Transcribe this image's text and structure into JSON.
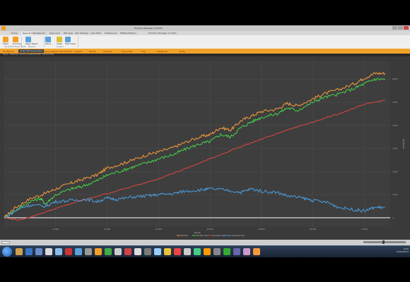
{
  "window": {
    "title": "Hold'em Manager 2 [Hold]"
  },
  "ribbon_tabs": [
    {
      "label": "Home",
      "active": false
    },
    {
      "label": "Reports",
      "active": true
    },
    {
      "label": "Multi-Reports",
      "active": false
    },
    {
      "label": "Opponent",
      "active": false
    },
    {
      "label": "HM Apps",
      "active": false
    },
    {
      "label": "Site Settings",
      "active": false
    },
    {
      "label": "Leak Filter",
      "active": false
    },
    {
      "label": "Preferences",
      "active": false
    },
    {
      "label": "HMHandhistory",
      "active": false
    },
    {
      "label": "Hold'em Manager 2 (Hold)",
      "active": false
    }
  ],
  "ribbon": {
    "buttons": [
      {
        "label": "Filters",
        "color": "#f2a023"
      },
      {
        "label": "Summary",
        "color": "#f2a023"
      },
      {
        "label": "Player Report",
        "color": "#5aa0dc"
      },
      {
        "label": "Hands",
        "color": "#5aa0dc"
      },
      {
        "label": "Graph",
        "color": "#e1c02e"
      },
      {
        "label": "Table Views",
        "color": "#5aa0dc"
      }
    ],
    "groups": [
      "Show/Hide Player Stats",
      "Reports",
      "Graphs"
    ]
  },
  "doc_tabs": [
    {
      "label": "My Reports",
      "active": false
    },
    {
      "label": "Graph Winnings Graph",
      "active": true
    },
    {
      "label": "Session/Hands",
      "active": false
    },
    {
      "label": "Hand History",
      "active": false
    },
    {
      "label": "Graphs",
      "active": false
    },
    {
      "label": "Results",
      "active": false
    },
    {
      "label": "Positions",
      "active": false
    },
    {
      "label": "Hole Cards",
      "active": false
    },
    {
      "label": "Flop",
      "active": false
    },
    {
      "label": "Situational",
      "active": false
    },
    {
      "label": "Notes",
      "active": false
    }
  ],
  "subbar": {
    "text": "Player: [Default]  Currency: [Default]  Filter: Default Filter"
  },
  "colors": {
    "chart_bg": "#3a3a3a",
    "orange": "#f39a3c",
    "green": "#45d24a",
    "red": "#e0473f",
    "blue": "#4a9ee0"
  },
  "chart_data": {
    "type": "line",
    "xlabel": "Hands",
    "ylabel": "Big Blinds",
    "x_ticks": [
      "10,000",
      "20,000",
      "30,000",
      "40,000",
      "50,000",
      "60,000",
      "70,000"
    ],
    "y_ticks": [
      "0",
      "1,000",
      "2,000",
      "3,000",
      "4,000",
      "5,000",
      "6,000"
    ],
    "xlim": [
      0,
      75000
    ],
    "ylim": [
      -400,
      6800
    ],
    "grid": true,
    "legend_placement": "bottom-center",
    "series": [
      {
        "name": "Net Won",
        "color": "#f39a3c",
        "values": [
          [
            0,
            0
          ],
          [
            2000,
            420
          ],
          [
            5000,
            820
          ],
          [
            8000,
            1060
          ],
          [
            10000,
            1250
          ],
          [
            13000,
            1500
          ],
          [
            15000,
            1650
          ],
          [
            18000,
            1850
          ],
          [
            20000,
            2150
          ],
          [
            23000,
            2350
          ],
          [
            25000,
            2500
          ],
          [
            28000,
            2750
          ],
          [
            30000,
            2850
          ],
          [
            33000,
            3050
          ],
          [
            35000,
            3250
          ],
          [
            38000,
            3500
          ],
          [
            40000,
            3600
          ],
          [
            42000,
            3900
          ],
          [
            44000,
            3800
          ],
          [
            46000,
            4200
          ],
          [
            48000,
            4400
          ],
          [
            50000,
            4600
          ],
          [
            53000,
            4700
          ],
          [
            55000,
            4950
          ],
          [
            57000,
            4850
          ],
          [
            60000,
            5150
          ],
          [
            62000,
            5350
          ],
          [
            65000,
            5550
          ],
          [
            68000,
            5800
          ],
          [
            70000,
            6050
          ],
          [
            72000,
            6250
          ],
          [
            74000,
            6250
          ]
        ]
      },
      {
        "name": "Net Won (EV)",
        "color": "#45d24a",
        "values": [
          [
            0,
            0
          ],
          [
            2000,
            300
          ],
          [
            5000,
            700
          ],
          [
            7000,
            850
          ],
          [
            8000,
            600
          ],
          [
            10000,
            1000
          ],
          [
            13000,
            1250
          ],
          [
            15000,
            1350
          ],
          [
            18000,
            1600
          ],
          [
            20000,
            1850
          ],
          [
            23000,
            2050
          ],
          [
            25000,
            2200
          ],
          [
            28000,
            2400
          ],
          [
            30000,
            2550
          ],
          [
            33000,
            2750
          ],
          [
            35000,
            2950
          ],
          [
            38000,
            3200
          ],
          [
            40000,
            3300
          ],
          [
            42000,
            3600
          ],
          [
            44000,
            3500
          ],
          [
            46000,
            3900
          ],
          [
            48000,
            4150
          ],
          [
            50000,
            4350
          ],
          [
            53000,
            4500
          ],
          [
            55000,
            4750
          ],
          [
            57000,
            4650
          ],
          [
            60000,
            5000
          ],
          [
            62000,
            5200
          ],
          [
            65000,
            5350
          ],
          [
            68000,
            5600
          ],
          [
            70000,
            5800
          ],
          [
            72000,
            6000
          ],
          [
            74000,
            6000
          ]
        ]
      },
      {
        "name": "Showdown Won",
        "color": "#e0473f",
        "values": [
          [
            0,
            0
          ],
          [
            3000,
            -100
          ],
          [
            6000,
            100
          ],
          [
            10000,
            400
          ],
          [
            15000,
            750
          ],
          [
            20000,
            1050
          ],
          [
            25000,
            1350
          ],
          [
            30000,
            1700
          ],
          [
            35000,
            2100
          ],
          [
            40000,
            2550
          ],
          [
            45000,
            3000
          ],
          [
            50000,
            3400
          ],
          [
            55000,
            3800
          ],
          [
            60000,
            4150
          ],
          [
            65000,
            4500
          ],
          [
            70000,
            4900
          ],
          [
            74000,
            5100
          ]
        ]
      },
      {
        "name": "Non-Showdown Won",
        "color": "#4a9ee0",
        "values": [
          [
            0,
            0
          ],
          [
            3000,
            400
          ],
          [
            5000,
            550
          ],
          [
            8000,
            500
          ],
          [
            10000,
            700
          ],
          [
            13000,
            750
          ],
          [
            16000,
            800
          ],
          [
            18000,
            700
          ],
          [
            20000,
            850
          ],
          [
            22000,
            800
          ],
          [
            25000,
            900
          ],
          [
            28000,
            950
          ],
          [
            30000,
            1000
          ],
          [
            33000,
            1050
          ],
          [
            35000,
            1150
          ],
          [
            38000,
            1200
          ],
          [
            40000,
            1250
          ],
          [
            43000,
            1200
          ],
          [
            46000,
            1100
          ],
          [
            48000,
            1250
          ],
          [
            50000,
            1150
          ],
          [
            53000,
            1100
          ],
          [
            55000,
            950
          ],
          [
            58000,
            850
          ],
          [
            60000,
            750
          ],
          [
            63000,
            650
          ],
          [
            65000,
            450
          ],
          [
            68000,
            350
          ],
          [
            70000,
            300
          ],
          [
            72000,
            450
          ],
          [
            74000,
            450
          ]
        ]
      }
    ]
  },
  "taskbar": {
    "clock_time": "6:00",
    "clock_date": "10/22/2013"
  }
}
